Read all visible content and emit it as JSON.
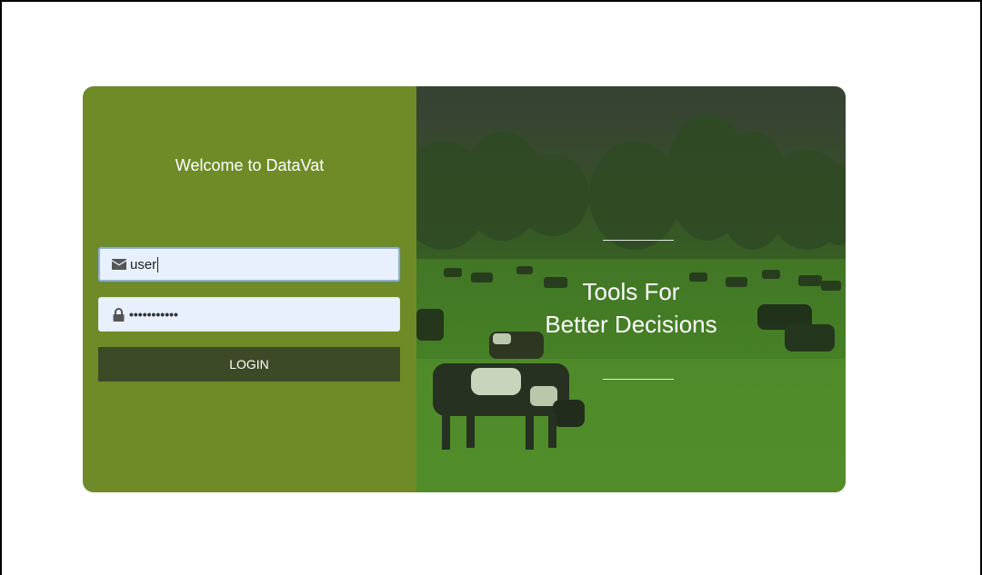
{
  "login_panel": {
    "welcome": "Welcome to DataVat",
    "username_value": "user",
    "password_mask": "•••••••••••",
    "login_label": "LOGIN",
    "icons": {
      "username": "envelope-icon",
      "password": "lock-icon"
    }
  },
  "hero": {
    "tagline_line1": "Tools For",
    "tagline_line2": "Better Decisions"
  },
  "colors": {
    "panel_green": "#6e8b28",
    "button_dark": "#3c4a28",
    "input_bg": "#e8f0fe"
  }
}
